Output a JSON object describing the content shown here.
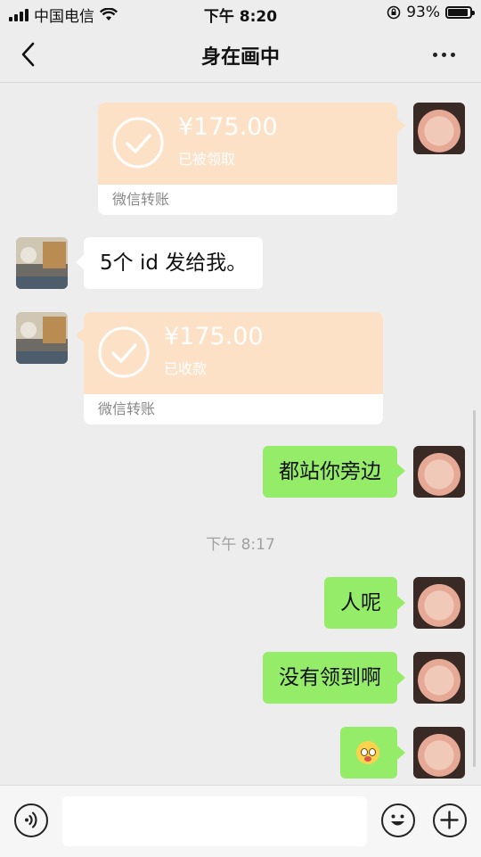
{
  "status_bar": {
    "carrier": "中国电信",
    "time": "下午 8:20",
    "battery": "93%"
  },
  "nav": {
    "title": "身在画中"
  },
  "messages": {
    "transfer_1": {
      "amount": "¥175.00",
      "status": "已被领取",
      "label": "微信转账"
    },
    "text_1": "5个 id 发给我。",
    "transfer_2": {
      "amount": "¥175.00",
      "status": "已收款",
      "label": "微信转账"
    },
    "text_2": "都站你旁边",
    "timestamp": "下午 8:17",
    "text_3": "人呢",
    "text_4": "没有领到啊"
  },
  "colors": {
    "background": "#ededed",
    "bubble_green": "#95ec69",
    "transfer_orange": "#fde1c6"
  },
  "icons": [
    "back-icon",
    "more-icon",
    "voice-icon",
    "emoji-icon",
    "plus-icon",
    "check-icon",
    "wifi-icon",
    "battery-icon",
    "signal-icon",
    "rotation-lock-icon"
  ]
}
